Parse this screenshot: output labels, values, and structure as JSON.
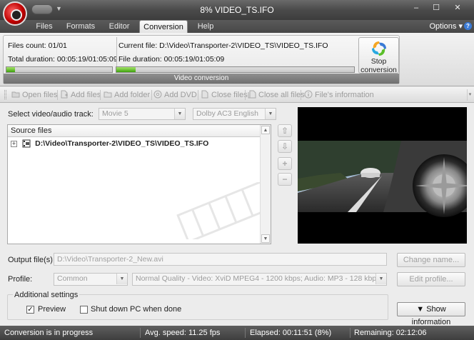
{
  "window": {
    "title": "8% VIDEO_TS.IFO",
    "min": "–",
    "max": "☐",
    "close": "✕"
  },
  "menu": {
    "tabs": [
      "Files",
      "Formats",
      "Editor",
      "Conversion",
      "Help"
    ],
    "active": "Conversion",
    "options": "Options",
    "options_arrow": "▾",
    "help_icon": "?"
  },
  "ribbon": {
    "files_count": "Files count: 01/01",
    "total_duration": "Total duration: 00:05:19/01:05:09",
    "current_file": "Current file: D:\\Video\\Transporter-2\\VIDEO_TS\\VIDEO_TS.IFO",
    "file_duration": "File duration: 00:05:19/01:05:09",
    "group_caption": "Video conversion",
    "total_progress": 0.08,
    "file_progress": 0.08,
    "stop_line1": "Stop",
    "stop_line2": "conversion",
    "stop_arrow": "▾"
  },
  "toolbar": {
    "open_files": "Open files",
    "add_files": "Add files",
    "add_folder": "Add folder",
    "add_dvd": "Add DVD",
    "close_files": "Close files",
    "close_all": "Close all files",
    "file_info": "File's information",
    "overflow": "▾"
  },
  "track": {
    "label": "Select video/audio track:",
    "video": "Movie 5",
    "audio": "Dolby AC3 English",
    "arrow": "▼"
  },
  "source": {
    "header": "Source files",
    "expander": "+",
    "file": "D:\\Video\\Transporter-2\\VIDEO_TS\\VIDEO_TS.IFO",
    "scroll_up": "▲",
    "scroll_down": "▼"
  },
  "side_tools": {
    "up": "⇧",
    "down": "⇩",
    "add": "+",
    "remove": "−"
  },
  "output": {
    "label": "Output file(s):",
    "value": "D:\\Video\\Transporter-2_New.avi",
    "change_name": "Change name..."
  },
  "profile": {
    "label": "Profile:",
    "category": "Common",
    "preset": "Normal Quality - Video: XviD MPEG4 - 1200 kbps; Audio: MP3 - 128 kbps",
    "edit": "Edit profile...",
    "arrow": "▼"
  },
  "settings": {
    "title": "Additional settings",
    "preview_label": "Preview",
    "preview_checked": true,
    "shutdown_label": "Shut down PC when done",
    "shutdown_checked": false,
    "check_mark": "✓",
    "show_info": "▼ Show information"
  },
  "status": {
    "message": "Conversion is in progress",
    "speed": "Avg. speed: 11.25 fps",
    "elapsed": "Elapsed: 00:11:51 (8%)",
    "remaining": "Remaining: 02:12:06"
  },
  "colors": {
    "progress": "#4caf1a",
    "statusbar": "#4a4a4a",
    "accent": "#3b7bd6"
  }
}
